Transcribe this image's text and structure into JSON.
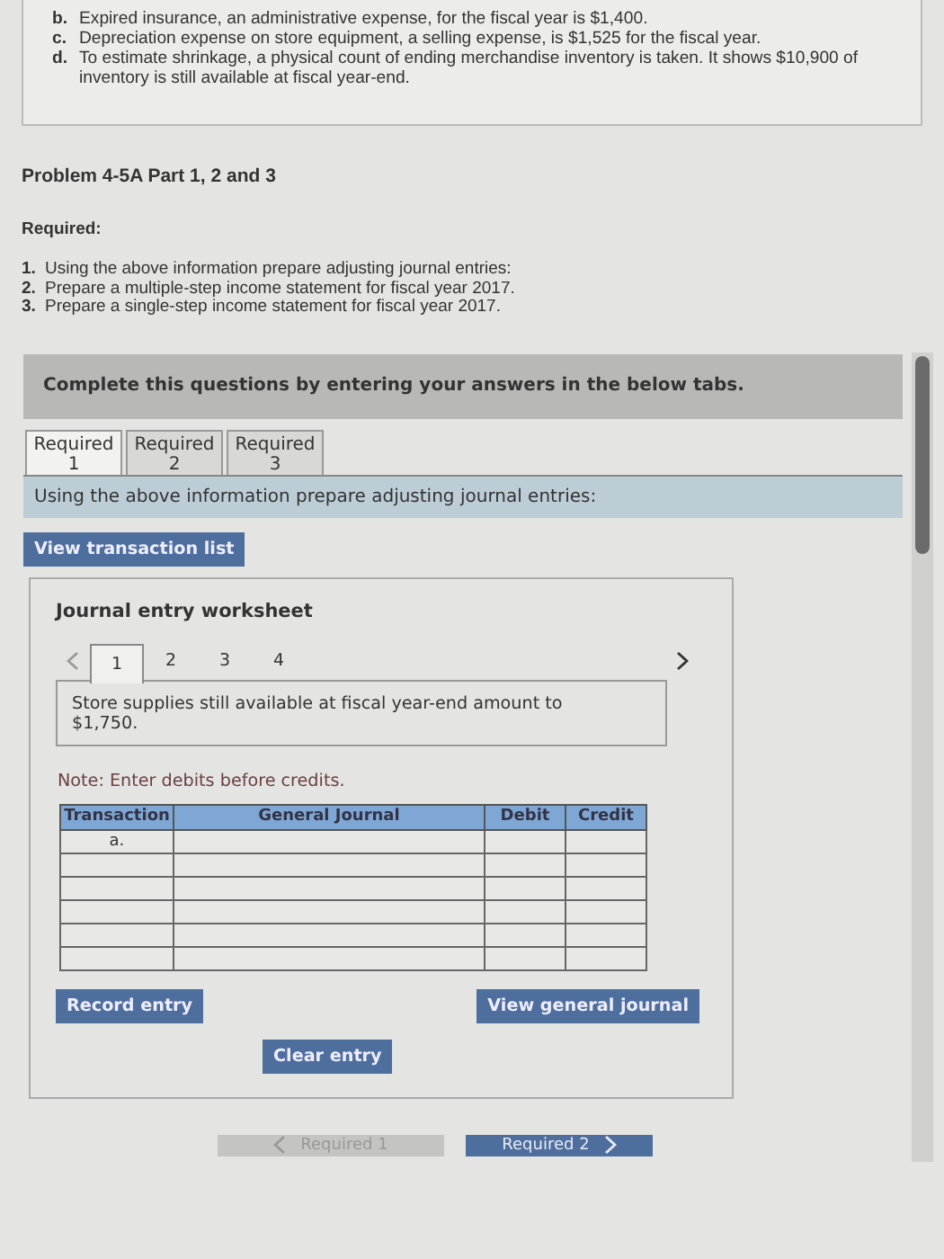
{
  "intro_items": [
    {
      "marker": "b.",
      "text": "Expired insurance, an administrative expense, for the fiscal year is $1,400."
    },
    {
      "marker": "c.",
      "text": "Depreciation expense on store equipment, a selling expense, is $1,525 for the fiscal year."
    },
    {
      "marker": "d.",
      "text": "To estimate shrinkage, a physical count of ending merchandise inventory is taken. It shows $10,900 of inventory is still available at fiscal year-end."
    }
  ],
  "problem_title": "Problem 4-5A Part 1, 2 and 3",
  "required_label": "Required:",
  "requirements": [
    {
      "marker": "1.",
      "text": "Using the above information prepare adjusting journal entries:"
    },
    {
      "marker": "2.",
      "text": "Prepare a multiple-step income statement for fiscal year 2017."
    },
    {
      "marker": "3.",
      "text": "Prepare a single-step income statement for fiscal year 2017."
    }
  ],
  "instructions_banner": "Complete this questions by entering your answers in the below tabs.",
  "tabs": [
    {
      "label": "Required",
      "number": "1",
      "selected": true
    },
    {
      "label": "Required",
      "number": "2",
      "selected": false
    },
    {
      "label": "Required",
      "number": "3",
      "selected": false
    }
  ],
  "tab_prompt": "Using the above information prepare adjusting journal entries:",
  "view_transaction_button": "View transaction list",
  "worksheet": {
    "title": "Journal entry worksheet",
    "steps": [
      {
        "label": "1",
        "selected": true
      },
      {
        "label": "2",
        "selected": false
      },
      {
        "label": "3",
        "selected": false
      },
      {
        "label": "4",
        "selected": false
      }
    ],
    "description": "Store supplies still available at fiscal year-end amount to $1,750.",
    "note": "Note: Enter debits before credits.",
    "table": {
      "columns": [
        "Transaction",
        "General Journal",
        "Debit",
        "Credit"
      ],
      "rows": [
        {
          "transaction": "a."
        },
        {},
        {},
        {},
        {},
        {}
      ]
    },
    "record_button": "Record entry",
    "view_journal_button": "View general journal",
    "clear_button": "Clear entry"
  },
  "nav": [
    {
      "label": "Required 1",
      "kind": "prev",
      "disabled": true
    },
    {
      "label": "Required 2",
      "kind": "next",
      "disabled": false
    }
  ]
}
